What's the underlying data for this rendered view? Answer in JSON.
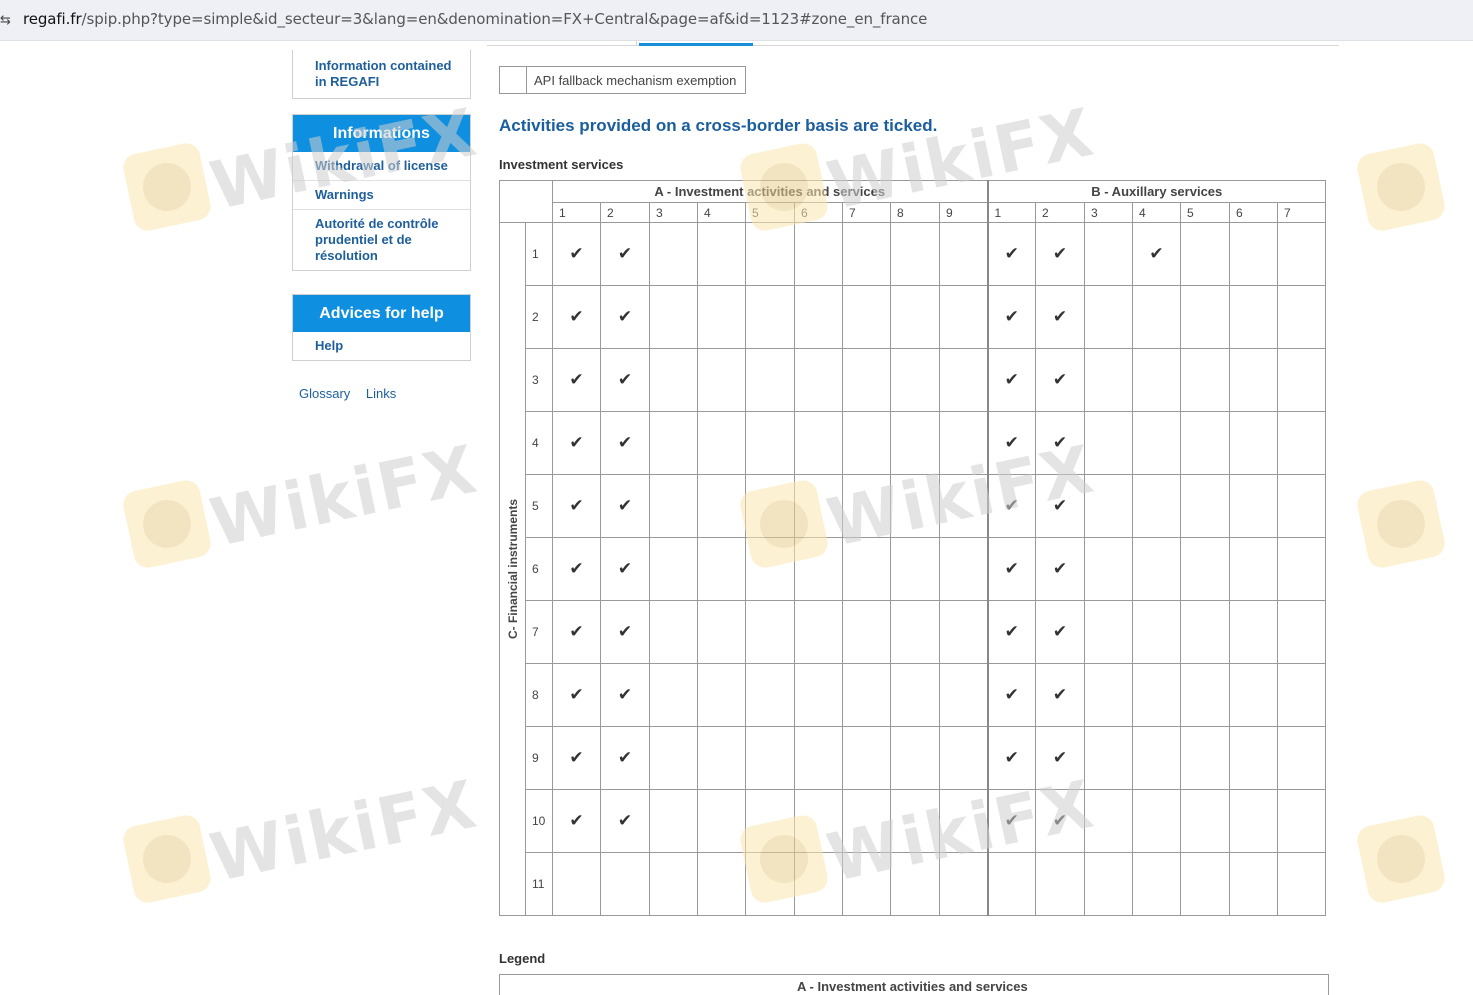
{
  "browser": {
    "url_domain": "regafi.fr",
    "url_path": "/spip.php?type=simple&id_secteur=3&lang=en&denomination=FX+Central&page=af&id=1123#zone_en_france"
  },
  "sidebar": {
    "top_item": "Information contained in REGAFI",
    "informations": {
      "title": "Informations",
      "items": [
        "Withdrawal of license",
        "Warnings",
        "Autorité de contrôle prudentiel et de résolution"
      ]
    },
    "advices": {
      "title": "Advices for help",
      "items": [
        "Help"
      ]
    },
    "footer_links": [
      "Glossary",
      "Links"
    ]
  },
  "main": {
    "api_checkbox_label": "API fallback mechanism exemption",
    "heading": "Activities provided on a cross-border basis are ticked.",
    "subheading": "Investment services",
    "table": {
      "group_a": "A - Investment activities and services",
      "group_b": "B - Auxillary services",
      "row_group_label": "C- Financial instruments",
      "a_columns": [
        "1",
        "2",
        "3",
        "4",
        "5",
        "6",
        "7",
        "8",
        "9"
      ],
      "b_columns": [
        "1",
        "2",
        "3",
        "4",
        "5",
        "6",
        "7"
      ],
      "check_mark": "✔",
      "rows": [
        {
          "label": "1",
          "a": [
            1,
            1,
            0,
            0,
            0,
            0,
            0,
            0,
            0
          ],
          "b": [
            1,
            1,
            0,
            1,
            0,
            0,
            0
          ]
        },
        {
          "label": "2",
          "a": [
            1,
            1,
            0,
            0,
            0,
            0,
            0,
            0,
            0
          ],
          "b": [
            1,
            1,
            0,
            0,
            0,
            0,
            0
          ]
        },
        {
          "label": "3",
          "a": [
            1,
            1,
            0,
            0,
            0,
            0,
            0,
            0,
            0
          ],
          "b": [
            1,
            1,
            0,
            0,
            0,
            0,
            0
          ]
        },
        {
          "label": "4",
          "a": [
            1,
            1,
            0,
            0,
            0,
            0,
            0,
            0,
            0
          ],
          "b": [
            1,
            1,
            0,
            0,
            0,
            0,
            0
          ]
        },
        {
          "label": "5",
          "a": [
            1,
            1,
            0,
            0,
            0,
            0,
            0,
            0,
            0
          ],
          "b": [
            1,
            1,
            0,
            0,
            0,
            0,
            0
          ]
        },
        {
          "label": "6",
          "a": [
            1,
            1,
            0,
            0,
            0,
            0,
            0,
            0,
            0
          ],
          "b": [
            1,
            1,
            0,
            0,
            0,
            0,
            0
          ]
        },
        {
          "label": "7",
          "a": [
            1,
            1,
            0,
            0,
            0,
            0,
            0,
            0,
            0
          ],
          "b": [
            1,
            1,
            0,
            0,
            0,
            0,
            0
          ]
        },
        {
          "label": "8",
          "a": [
            1,
            1,
            0,
            0,
            0,
            0,
            0,
            0,
            0
          ],
          "b": [
            1,
            1,
            0,
            0,
            0,
            0,
            0
          ]
        },
        {
          "label": "9",
          "a": [
            1,
            1,
            0,
            0,
            0,
            0,
            0,
            0,
            0
          ],
          "b": [
            1,
            1,
            0,
            0,
            0,
            0,
            0
          ]
        },
        {
          "label": "10",
          "a": [
            1,
            1,
            0,
            0,
            0,
            0,
            0,
            0,
            0
          ],
          "b": [
            1,
            1,
            0,
            0,
            0,
            0,
            0
          ]
        },
        {
          "label": "11",
          "a": [
            0,
            0,
            0,
            0,
            0,
            0,
            0,
            0,
            0
          ],
          "b": [
            0,
            0,
            0,
            0,
            0,
            0,
            0
          ]
        }
      ]
    },
    "legend_title": "Legend",
    "legend_first_line": "A - Investment activities and services"
  },
  "watermark": {
    "text": "WikiFX",
    "colors": {
      "text": "#cfcfcf",
      "logo": "#fbe8b0"
    }
  },
  "colors": {
    "accent": "#0e8fe0",
    "link": "#1e5f9b",
    "heading": "#1b5e9e"
  }
}
